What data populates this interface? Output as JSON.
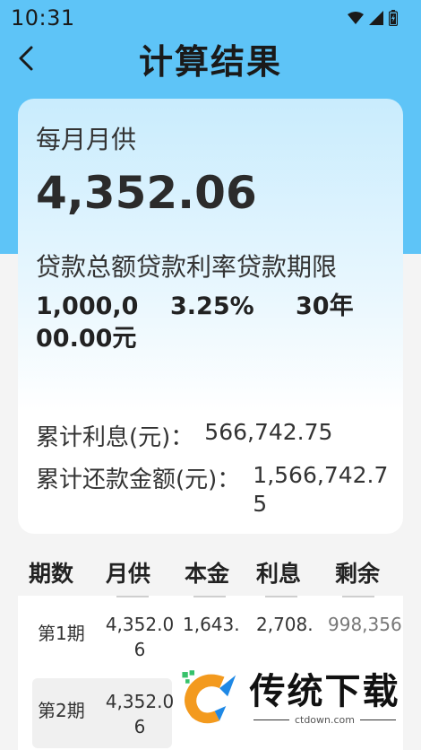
{
  "status_bar": {
    "time": "10:31"
  },
  "header": {
    "title": "计算结果"
  },
  "card": {
    "monthly_label": "每月月供",
    "monthly_value": "4,352.06",
    "summary_labels": "贷款总额贷款利率贷款期限",
    "loan_amount": "1,000,000.00元",
    "loan_rate": "3.25%",
    "loan_term": "30年",
    "total_interest_label": "累计利息(元)：",
    "total_interest_value": "566,742.75",
    "total_repay_label": "累计还款金额(元)：",
    "total_repay_value": "1,566,742.75"
  },
  "table": {
    "headers": [
      "期数",
      "月供",
      "本金",
      "利息",
      "剩余"
    ],
    "rows": [
      {
        "period": "第1期",
        "monthly": "4,352.06",
        "principal": "1,643.",
        "interest": "2,708.",
        "remaining": "998,356"
      },
      {
        "period": "第2期",
        "monthly": "4,352.06"
      }
    ]
  },
  "watermark": {
    "text": "传统下载",
    "url": "ctdown.com"
  },
  "colors": {
    "top_background": "#5ec4f7",
    "watermark_orange": "#f39a1e",
    "watermark_blue": "#1e88e5",
    "watermark_green": "#37c26b"
  }
}
